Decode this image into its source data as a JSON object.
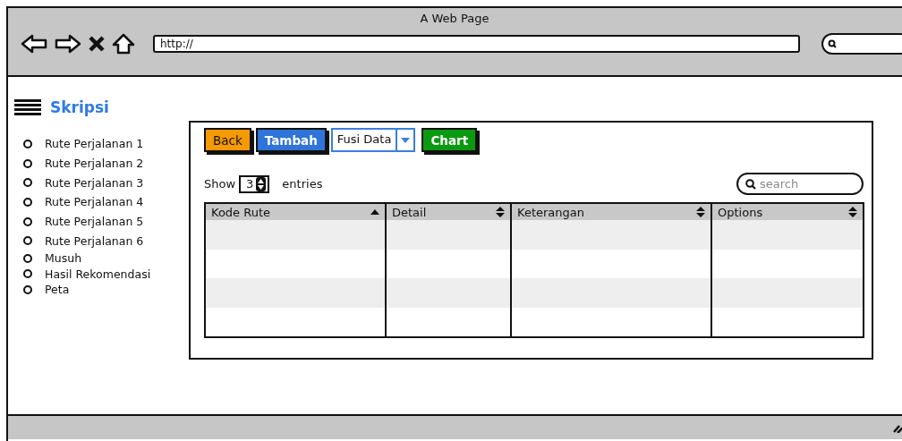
{
  "window": {
    "title": "A Web Page"
  },
  "browser": {
    "url": "http://"
  },
  "sidebar": {
    "title": "Skripsi",
    "items": [
      {
        "label": "Rute Perjalanan 1"
      },
      {
        "label": "Rute Perjalanan 2"
      },
      {
        "label": "Rute Perjalanan 3"
      },
      {
        "label": "Rute Perjalanan 4"
      },
      {
        "label": "Rute Perjalanan 5"
      },
      {
        "label": "Rute Perjalanan 6"
      },
      {
        "label": "Musuh"
      },
      {
        "label": "Hasil Rekomendasi"
      },
      {
        "label": "Peta"
      }
    ]
  },
  "toolbar": [
    {
      "kind": "button",
      "label": "Back",
      "color": "#f59a00"
    },
    {
      "kind": "button",
      "label": "Tambah",
      "color": "#2f74d9"
    },
    {
      "kind": "dropdown",
      "label": "Fusi Data"
    },
    {
      "kind": "button",
      "label": "Chart",
      "color": "#0a9a10"
    }
  ],
  "entries": {
    "before": "Show",
    "value": "3",
    "after": "entries"
  },
  "search": {
    "placeholder": "search"
  },
  "table": {
    "columns": [
      {
        "label": "Kode Rute",
        "sorted": true
      },
      {
        "label": "Detail",
        "sorted": false
      },
      {
        "label": "Keterangan",
        "sorted": false
      },
      {
        "label": "Options",
        "sorted": false
      }
    ]
  }
}
